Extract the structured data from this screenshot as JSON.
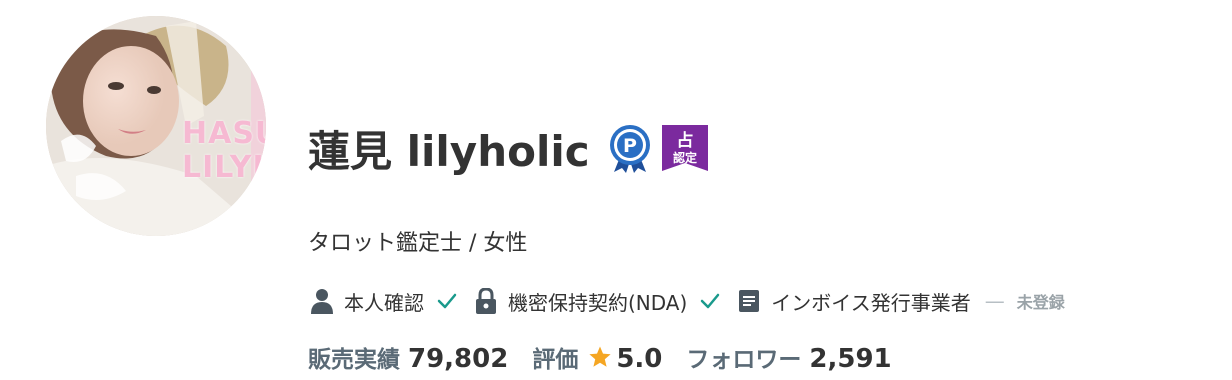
{
  "profile": {
    "name": "蓮見 lilyholic",
    "subtitle": "タロット鑑定士 / 女性",
    "avatar_text": [
      "HASU",
      "LILYHC"
    ],
    "badges": {
      "premium_icon": "p-ribbon-badge-icon",
      "fortune_badge": {
        "top": "占",
        "bottom": "認定"
      }
    },
    "verifications": [
      {
        "icon": "person-icon",
        "label": "本人確認",
        "status": "verified"
      },
      {
        "icon": "lock-icon",
        "label": "機密保持契約(NDA)",
        "status": "verified"
      },
      {
        "icon": "document-icon",
        "label": "インボイス発行事業者",
        "status": "未登録"
      }
    ],
    "stats": {
      "sales_label": "販売実績",
      "sales_value": "79,802",
      "rating_label": "評価",
      "rating_value": "5.0",
      "followers_label": "フォロワー",
      "followers_value": "2,591"
    }
  },
  "colors": {
    "check": "#1a9a8c",
    "icon": "#4a5660",
    "star": "#f5a623",
    "badge_purple": "#7b2a9e",
    "badge_blue": "#2a6fc4"
  }
}
